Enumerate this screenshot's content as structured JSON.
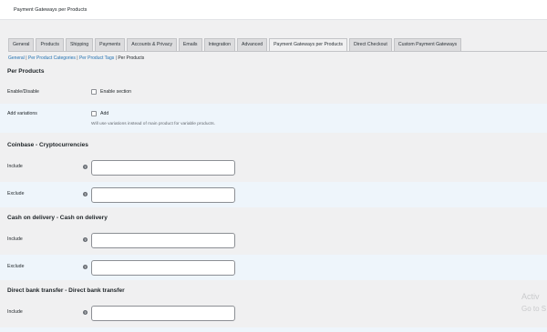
{
  "page_title": "Payment Gateways per Products",
  "tabs": [
    {
      "label": "General"
    },
    {
      "label": "Products"
    },
    {
      "label": "Shipping"
    },
    {
      "label": "Payments"
    },
    {
      "label": "Accounts & Privacy"
    },
    {
      "label": "Emails"
    },
    {
      "label": "Integration"
    },
    {
      "label": "Advanced"
    },
    {
      "label": "Payment Gateways per Products",
      "active": true
    },
    {
      "label": "Direct Checkout"
    },
    {
      "label": "Custom Payment Gateways"
    }
  ],
  "subnav": {
    "general": "General",
    "categories": "Per Product Categories",
    "tags": "Per Product Tags",
    "current": "Per Products",
    "sep": "|"
  },
  "per_products": {
    "title": "Per Products",
    "enable_label": "Enable/Disable",
    "enable_checkbox_label": "Enable section",
    "variations_label": "Add variations",
    "variations_checkbox_label": "Add",
    "variations_desc": "Will use variations instead of main product for variable products."
  },
  "gateways": [
    {
      "title": "Coinbase - Cryptocurrencies",
      "include_label": "Include",
      "exclude_label": "Exclude",
      "include_value": "",
      "exclude_value": ""
    },
    {
      "title": "Cash on delivery - Cash on delivery",
      "include_label": "Include",
      "exclude_label": "Exclude",
      "include_value": "",
      "exclude_value": ""
    },
    {
      "title": "Direct bank transfer - Direct bank transfer",
      "include_label": "Include",
      "include_value": ""
    }
  ],
  "help_glyph": "?",
  "watermark": {
    "line1": "Activ",
    "line2": "Go to S"
  }
}
